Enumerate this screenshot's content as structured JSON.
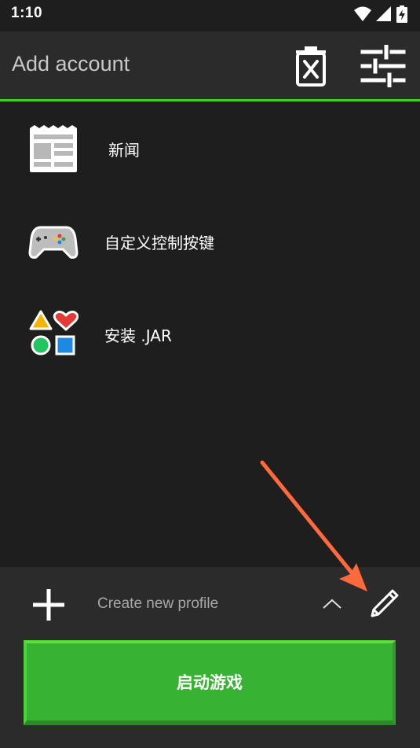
{
  "status_bar": {
    "time": "1:10",
    "icons": [
      "wifi-icon",
      "signal-icon",
      "battery-charging-icon"
    ]
  },
  "toolbar": {
    "title": "Add account",
    "actions": [
      "delete-account-icon",
      "settings-sliders-icon"
    ],
    "accent_color": "#44c82c"
  },
  "menu": {
    "items": [
      {
        "label": "新闻",
        "icon": "news-icon"
      },
      {
        "label": "自定义控制按键",
        "icon": "gamepad-icon"
      },
      {
        "label": "安装 .JAR",
        "icon": "shapes-icon"
      }
    ]
  },
  "bottom": {
    "add_icon": "plus-icon",
    "profile_label": "Create new profile",
    "caret_icon": "chevron-up-icon",
    "edit_icon": "pencil-icon",
    "launch_label": "启动游戏",
    "launch_color": "#38b233"
  },
  "annotation": {
    "arrow_color": "#ff6a3d"
  }
}
